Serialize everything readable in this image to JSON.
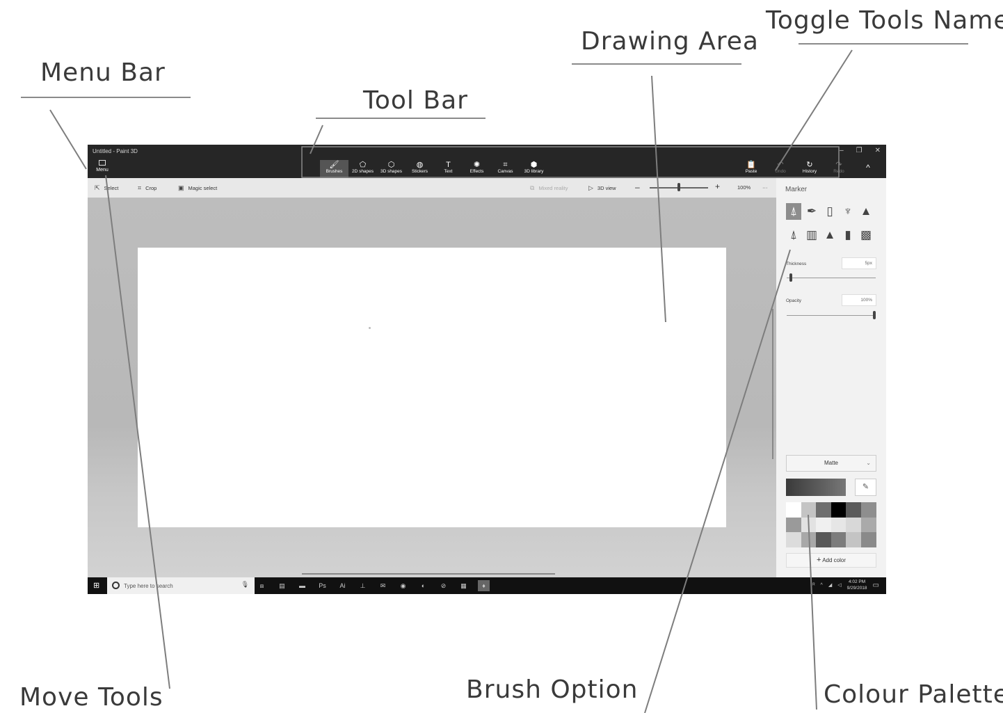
{
  "annotations": {
    "menu_bar": "Menu Bar",
    "tool_bar": "Tool Bar",
    "drawing_area": "Drawing Area",
    "toggle_tools_name": "Toggle Tools Name",
    "move_tools": "Move Tools",
    "brush_option": "Brush Option",
    "colour_palette": "Colour Palette"
  },
  "window": {
    "title": "Untitled - Paint 3D",
    "menu_label": "Menu",
    "controls": [
      "–",
      "❐",
      "✕"
    ]
  },
  "toolbar": {
    "tools": [
      {
        "label": "Brushes",
        "icon": "brush-icon",
        "glyph": "🖌",
        "active": true
      },
      {
        "label": "2D shapes",
        "icon": "2d-shapes-icon",
        "glyph": "⬠",
        "active": false
      },
      {
        "label": "3D shapes",
        "icon": "3d-shapes-icon",
        "glyph": "⬡",
        "active": false
      },
      {
        "label": "Stickers",
        "icon": "stickers-icon",
        "glyph": "◍",
        "active": false
      },
      {
        "label": "Text",
        "icon": "text-icon",
        "glyph": "T",
        "active": false
      },
      {
        "label": "Effects",
        "icon": "effects-icon",
        "glyph": "✺",
        "active": false
      },
      {
        "label": "Canvas",
        "icon": "canvas-icon",
        "glyph": "⌗",
        "active": false
      },
      {
        "label": "3D library",
        "icon": "3d-library-icon",
        "glyph": "⬢",
        "active": false
      }
    ],
    "right": [
      {
        "label": "Paste",
        "icon": "paste-icon",
        "glyph": "📋",
        "disabled": false
      },
      {
        "label": "Undo",
        "icon": "undo-icon",
        "glyph": "↶",
        "disabled": true
      },
      {
        "label": "History",
        "icon": "history-icon",
        "glyph": "↻",
        "disabled": false
      },
      {
        "label": "Redo",
        "icon": "redo-icon",
        "glyph": "↷",
        "disabled": true
      }
    ],
    "collapse_glyph": "^"
  },
  "subbar": {
    "select": "Select",
    "crop": "Crop",
    "magic_select": "Magic select",
    "mixed_reality": "Mixed reality",
    "view_3d": "3D view",
    "zoom": "100%",
    "more": "···"
  },
  "panel": {
    "title": "Marker",
    "brushes": [
      "marker-icon",
      "calligraphy-pen-icon",
      "oil-brush-icon",
      "watercolor-icon",
      "pixel-pen-icon",
      "pencil-icon",
      "eraser-icon",
      "crayon-icon",
      "spray-can-icon",
      "fill-icon"
    ],
    "thickness_label": "Thickness",
    "thickness_value": "5px",
    "thickness_level": 0.04,
    "opacity_label": "Opacity",
    "opacity_value": "100%",
    "opacity_level": 1.0,
    "finish": "Matte",
    "add_color": "Add color",
    "palette": [
      "#ffffff",
      "#c4c4c4",
      "#6e6e6e",
      "#000000",
      "#5a5a5a",
      "#8e8e8e",
      "#9a9a9a",
      "#e2e2e2",
      "#f0f0f0",
      "#e6e6e6",
      "#d8d8d8",
      "#aaaaaa",
      "#dcdcdc",
      "#a8a8a8",
      "#585858",
      "#7c7c7c",
      "#c4c4c4",
      "#8a8a8a"
    ]
  },
  "taskbar": {
    "search_placeholder": "Type here to search",
    "time": "4:02 PM",
    "date": "9/29/2018"
  }
}
